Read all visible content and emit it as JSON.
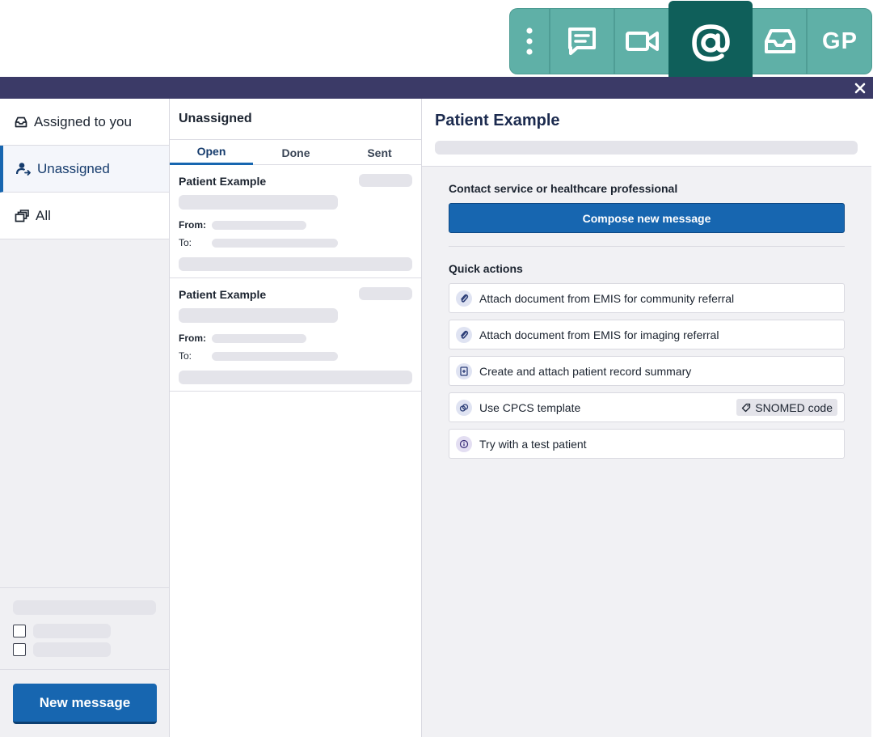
{
  "toolbar": {
    "items": [
      {
        "icon": "more-vertical-icon"
      },
      {
        "icon": "chat-icon"
      },
      {
        "icon": "video-camera-icon"
      },
      {
        "icon": "at-sign-icon",
        "active": true
      },
      {
        "icon": "inbox-icon"
      },
      {
        "label": "GP"
      }
    ],
    "colors": {
      "bar": "#5fb0a7",
      "active": "#0f5f5a",
      "band": "#3b3a67"
    }
  },
  "sidebar": {
    "items": [
      {
        "label": "Assigned to you",
        "icon": "inbox-icon"
      },
      {
        "label": "Unassigned",
        "icon": "unassigned-user-icon",
        "active": true
      },
      {
        "label": "All",
        "icon": "stack-icon"
      }
    ],
    "new_message_label": "New message"
  },
  "list": {
    "title": "Unassigned",
    "tabs": [
      "Open",
      "Done",
      "Sent"
    ],
    "active_tab": "Open",
    "messages": [
      {
        "name": "Patient Example",
        "from_label": "From:",
        "to_label": "To:"
      },
      {
        "name": "Patient Example",
        "from_label": "From:",
        "to_label": "To:"
      }
    ]
  },
  "detail": {
    "title": "Patient Example",
    "contact_heading": "Contact service or healthcare professional",
    "compose_label": "Compose new message",
    "quick_actions_heading": "Quick actions",
    "quick_actions": [
      {
        "label": "Attach document from EMIS for community referral",
        "icon": "paperclip-icon"
      },
      {
        "label": "Attach document from EMIS for imaging referral",
        "icon": "paperclip-icon"
      },
      {
        "label": "Create and attach patient record summary",
        "icon": "document-icon"
      },
      {
        "label": "Use CPCS template",
        "icon": "pill-icon",
        "tag": "SNOMED code"
      },
      {
        "label": "Try with a test patient",
        "icon": "info-icon"
      }
    ],
    "accent": "#1766b0"
  }
}
